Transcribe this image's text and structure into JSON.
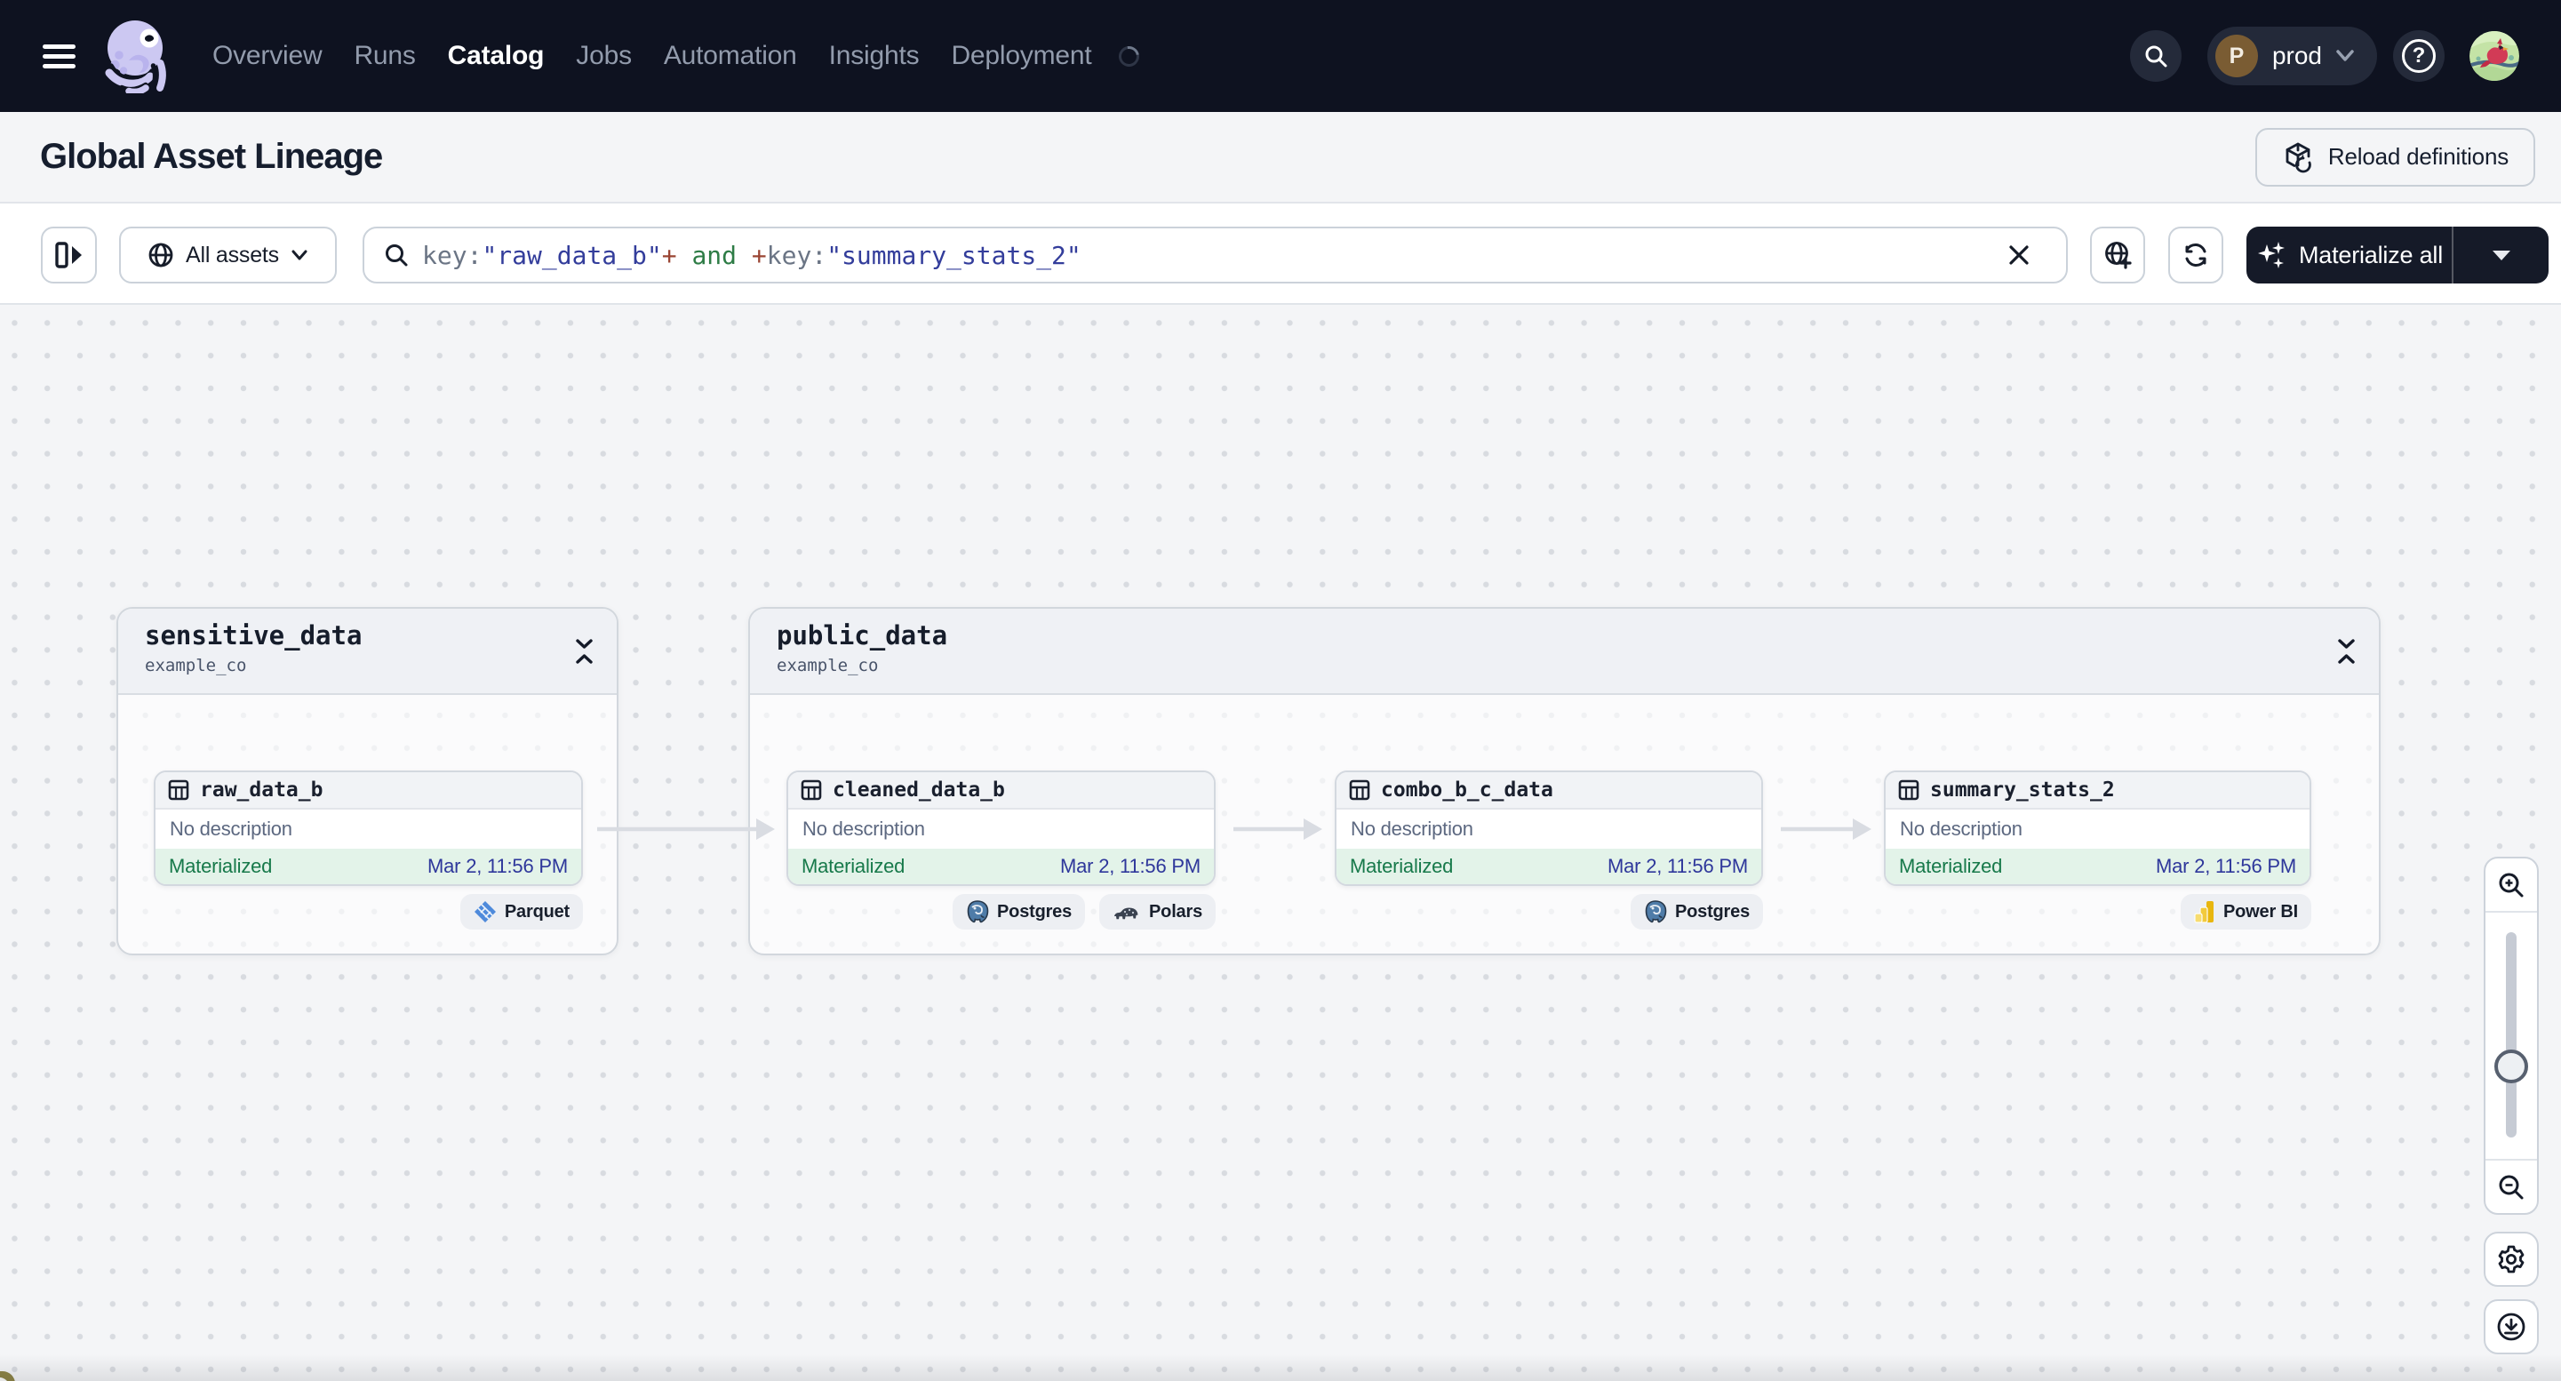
{
  "nav": {
    "items": [
      {
        "label": "Overview",
        "active": false
      },
      {
        "label": "Runs",
        "active": false
      },
      {
        "label": "Catalog",
        "active": true
      },
      {
        "label": "Jobs",
        "active": false
      },
      {
        "label": "Automation",
        "active": false
      },
      {
        "label": "Insights",
        "active": false
      },
      {
        "label": "Deployment",
        "active": false
      }
    ],
    "environment": {
      "initial": "P",
      "name": "prod"
    },
    "help_glyph": "?"
  },
  "header": {
    "title": "Global Asset Lineage",
    "reload_button": "Reload definitions"
  },
  "toolbar": {
    "scope_button": "All assets",
    "materialize_button": "Materialize all",
    "query": {
      "seg0": "key:",
      "seg1": "\"raw_data_b\"",
      "seg2": "+",
      "seg3": " and ",
      "seg4": "+",
      "seg5": "key:",
      "seg6": "\"summary_stats_2\""
    }
  },
  "graph": {
    "groups": [
      {
        "name": "sensitive_data",
        "repo": "example_co"
      },
      {
        "name": "public_data",
        "repo": "example_co"
      }
    ],
    "nodes": [
      {
        "name": "raw_data_b",
        "description": "No description",
        "status": "Materialized",
        "timestamp": "Mar 2, 11:56 PM",
        "tags": [
          {
            "label": "Parquet"
          }
        ]
      },
      {
        "name": "cleaned_data_b",
        "description": "No description",
        "status": "Materialized",
        "timestamp": "Mar 2, 11:56 PM",
        "tags": [
          {
            "label": "Postgres"
          },
          {
            "label": "Polars"
          }
        ]
      },
      {
        "name": "combo_b_c_data",
        "description": "No description",
        "status": "Materialized",
        "timestamp": "Mar 2, 11:56 PM",
        "tags": [
          {
            "label": "Postgres"
          }
        ]
      },
      {
        "name": "summary_stats_2",
        "description": "No description",
        "status": "Materialized",
        "timestamp": "Mar 2, 11:56 PM",
        "tags": [
          {
            "label": "Power BI"
          }
        ]
      }
    ]
  },
  "colors": {
    "navbar_bg": "#0E1220",
    "accent_dark_button": "#151A28",
    "materialized_green": "#17794A",
    "materialized_bg": "#E3F3E9",
    "timestamp_indigo": "#2E379B",
    "query_value_indigo": "#333D9B",
    "query_op_red": "#9A4433",
    "query_logic_green": "#2E7C46",
    "canvas_bg": "#F4F5F7"
  }
}
